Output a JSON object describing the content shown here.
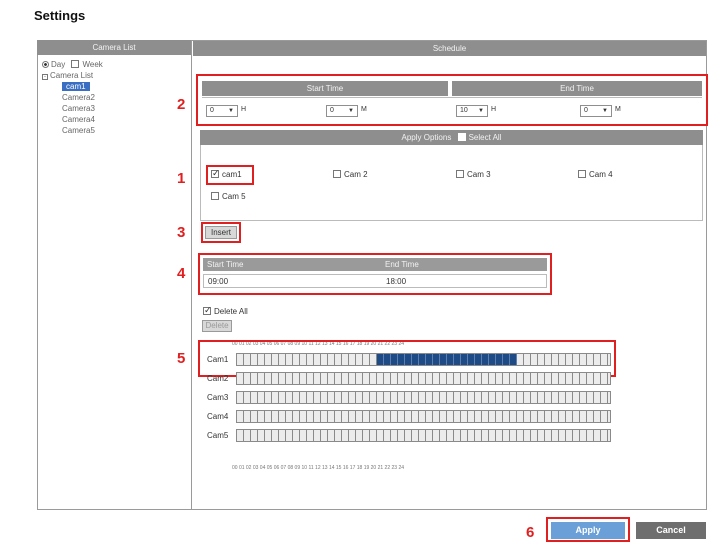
{
  "title": "Settings",
  "left": {
    "header": "Camera List",
    "mode_day": "Day",
    "mode_week": "Week",
    "tree_root": "Camera List",
    "cameras": [
      "cam1",
      "Camera2",
      "Camera3",
      "Camera4",
      "Camera5"
    ]
  },
  "schedule": {
    "header": "Schedule",
    "start_time_label": "Start Time",
    "end_time_label": "End Time",
    "start_hour": "0",
    "start_hour_unit": "H",
    "start_min": "0",
    "start_min_unit": "M",
    "end_hour": "10",
    "end_hour_unit": "H",
    "end_min": "0",
    "end_min_unit": "M",
    "apply_options": "Apply Options",
    "select_all": "Select All",
    "cams": [
      "cam1",
      "Cam 2",
      "Cam 3",
      "Cam 4",
      "Cam 5"
    ],
    "insert": "Insert",
    "table_start": "Start Time",
    "table_end": "End Time",
    "row_start": "09:00",
    "row_end": "18:00",
    "delete_all": "Delete All",
    "delete": "Delete",
    "grid_rows": [
      "Cam1",
      "Cam2",
      "Cam3",
      "Cam4",
      "Cam5"
    ],
    "hours": "00 01 02 03 04 05 06 07 08 09 10 11 12 13 14 15 16 17 18 19 20 21 22 23 24",
    "blue_start_hour": 9,
    "blue_end_hour": 18
  },
  "steps": [
    "1",
    "2",
    "3",
    "4",
    "5",
    "6"
  ],
  "footer": {
    "apply": "Apply",
    "cancel": "Cancel"
  }
}
